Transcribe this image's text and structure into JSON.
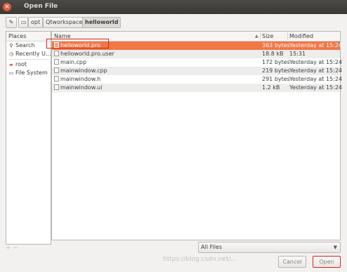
{
  "window": {
    "title": "Open File",
    "close_glyph": "×"
  },
  "pathbar": {
    "segments": [
      "opt",
      "Qtworkspace",
      "helloworld"
    ]
  },
  "places": {
    "header": "Places",
    "items": [
      {
        "label": "Search",
        "icon": "search-icon",
        "glyph": "⚲"
      },
      {
        "label": "Recently U...",
        "icon": "clock-icon",
        "glyph": "◷"
      },
      {
        "label": "root",
        "icon": "home-folder-icon",
        "glyph": "▰"
      },
      {
        "label": "File System",
        "icon": "drive-icon",
        "glyph": "▭"
      }
    ],
    "footer": "+  −"
  },
  "files": {
    "columns": {
      "name": "Name",
      "size": "Size",
      "modified": "Modified"
    },
    "rows": [
      {
        "name": "helloworld.pro",
        "size": "363 bytes",
        "modified": "Yesterday at 15:24"
      },
      {
        "name": "helloworld.pro.user",
        "size": "18.8 kB",
        "modified": "15:31"
      },
      {
        "name": "main.cpp",
        "size": "172 bytes",
        "modified": "Yesterday at 15:24"
      },
      {
        "name": "mainwindow.cpp",
        "size": "219 bytes",
        "modified": "Yesterday at 15:24"
      },
      {
        "name": "mainwindow.h",
        "size": "291 bytes",
        "modified": "Yesterday at 15:24"
      },
      {
        "name": "mainwindow.ui",
        "size": "1.2 kB",
        "modified": "Yesterday at 15:24"
      }
    ]
  },
  "filter": {
    "selected": "All Files"
  },
  "buttons": {
    "cancel": "Cancel",
    "open": "Open"
  },
  "watermark": "https://blog.csdn.net/..."
}
